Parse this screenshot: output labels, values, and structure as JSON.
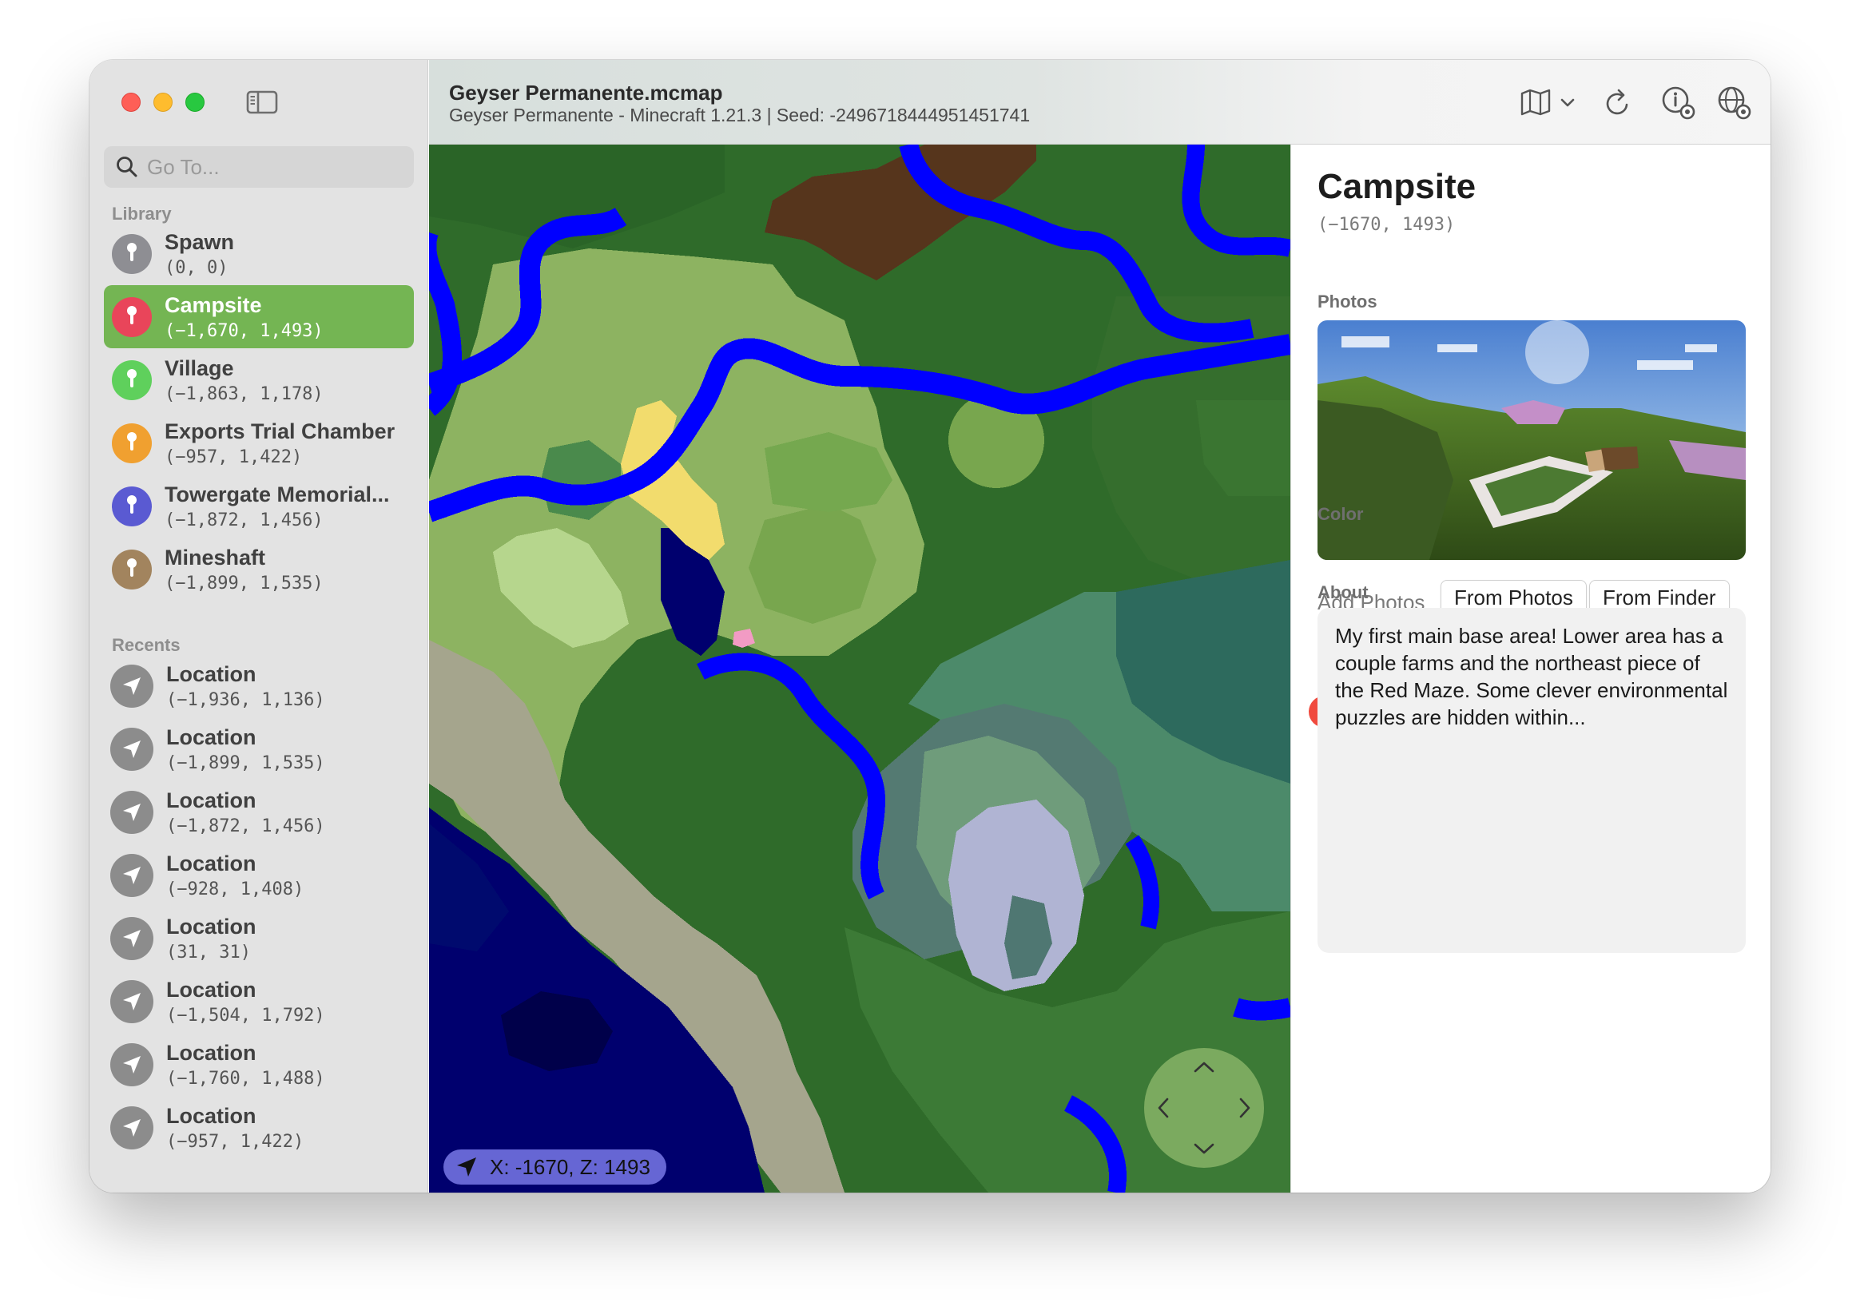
{
  "sidebar": {
    "search_placeholder": "Go To...",
    "library_title": "Library",
    "recents_title": "Recents",
    "library": [
      {
        "name": "Spawn",
        "coord": "(0, 0)",
        "color": "#8e8e93"
      },
      {
        "name": "Campsite",
        "coord": "(−1,670, 1,493)",
        "color": "#e9455a",
        "selected": true
      },
      {
        "name": "Village",
        "coord": "(−1,863, 1,178)",
        "color": "#5fd05c"
      },
      {
        "name": "Exports Trial Chamber",
        "coord": "(−957, 1,422)",
        "color": "#f0a030"
      },
      {
        "name": "Towergate Memorial...",
        "coord": "(−1,872, 1,456)",
        "color": "#5a5ad2"
      },
      {
        "name": "Mineshaft",
        "coord": "(−1,899, 1,535)",
        "color": "#a2845e"
      }
    ],
    "recents": [
      {
        "name": "Location",
        "coord": "(−1,936, 1,136)"
      },
      {
        "name": "Location",
        "coord": "(−1,899, 1,535)"
      },
      {
        "name": "Location",
        "coord": "(−1,872, 1,456)"
      },
      {
        "name": "Location",
        "coord": "(−928, 1,408)"
      },
      {
        "name": "Location",
        "coord": "(31, 31)"
      },
      {
        "name": "Location",
        "coord": "(−1,504, 1,792)"
      },
      {
        "name": "Location",
        "coord": "(−1,760, 1,488)"
      },
      {
        "name": "Location",
        "coord": "(−957, 1,422)"
      }
    ]
  },
  "titlebar": {
    "title": "Geyser Permanente.mcmap",
    "subtitle": "Geyser Permanente - Minecraft 1.21.3 | Seed: -2496718444951451741",
    "icons": [
      "map-icon",
      "chevron-down-icon",
      "refresh-icon",
      "info-gear-icon",
      "globe-gear-icon"
    ]
  },
  "map": {
    "coordinate_readout": "X: -1670, Z: 1493",
    "colors": {
      "ocean": "#00006e",
      "river": "#0000ff",
      "plains": "#8db361",
      "forest": "#2f6b2a",
      "beach": "#f2dc6d",
      "stone_shore": "#a5a58d",
      "mountain_snow": "#b0b4d3",
      "taiga": "#54796e",
      "dark_forest": "#56351c"
    }
  },
  "inspector": {
    "title": "Campsite",
    "coord": "(−1670, 1493)",
    "photos_label": "Photos",
    "add_photos_label": "Add Photos",
    "from_photos_label": "From Photos",
    "from_finder_label": "From Finder",
    "color_label": "Color",
    "about_label": "About",
    "about_text": "My first main base area! Lower area has a couple farms and the northeast piece of the Red Maze. Some clever environmental puzzles are hidden within...",
    "colors": [
      "#f04a3e",
      "#f79a2c",
      "#f6c333",
      "#5cc95a",
      "#2f8bf5",
      "#5b5bd6",
      "#a48a68",
      "#9b9ba0",
      "#f0475e"
    ],
    "selected_color_index": 8
  }
}
